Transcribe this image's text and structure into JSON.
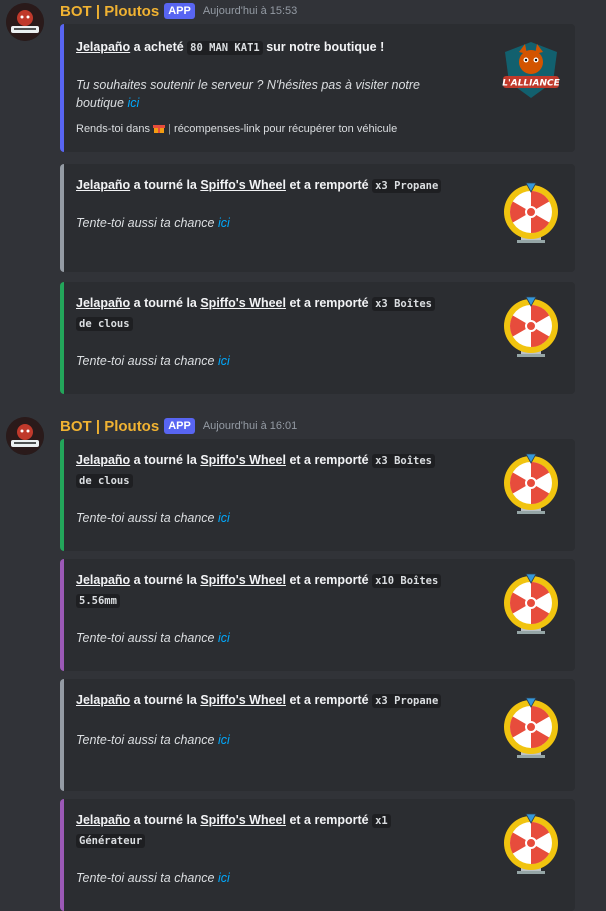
{
  "bot": {
    "name": "BOT | Ploutos",
    "badge": "APP",
    "time1": "Aujourd'hui à 15:53",
    "time2": "Aujourd'hui à 16:01"
  },
  "first_embed": {
    "user": "Jelapaño",
    "mid": " a acheté ",
    "item": "80 MAN KAT1",
    "end": " sur notre boutique !",
    "support_line1": "Tu souhaites soutenir le serveur ? N'hésites pas à visiter notre",
    "support_line2": "boutique ",
    "link": "ici",
    "footer_a": "Rends-toi dans ",
    "footer_sep": " | ",
    "footer_b": "récompenses-link pour récupérer ton véhicule",
    "color": "#5865f2"
  },
  "wheel_text": {
    "tourne": " a tourné la ",
    "wheel": "Spiffo's Wheel",
    "remporte": " et a remporté ",
    "tente": "Tente-toi aussi ta chance ",
    "link": "ici"
  },
  "spins": [
    {
      "user": "Jelapaño",
      "prize1": "x3 Propane",
      "prize2": "",
      "color": "#949ba4"
    },
    {
      "user": "Jelapaño",
      "prize1": "x3 Boîtes ",
      "prize2": "de clous",
      "color": "#23a55a"
    },
    {
      "user": "Jelapaño",
      "prize1": "x3 Boîtes ",
      "prize2": "de clous",
      "color": "#23a55a"
    },
    {
      "user": "Jelapaño",
      "prize1": "x10 Boîtes ",
      "prize2": "5.56mm",
      "color": "#9b59b6"
    },
    {
      "user": "Jelapaño",
      "prize1": "x3 Propane",
      "prize2": "",
      "color": "#949ba4"
    },
    {
      "user": "Jelapaño",
      "prize1": "x1 ",
      "prize2": "Générateur",
      "color": "#9b59b6"
    }
  ]
}
